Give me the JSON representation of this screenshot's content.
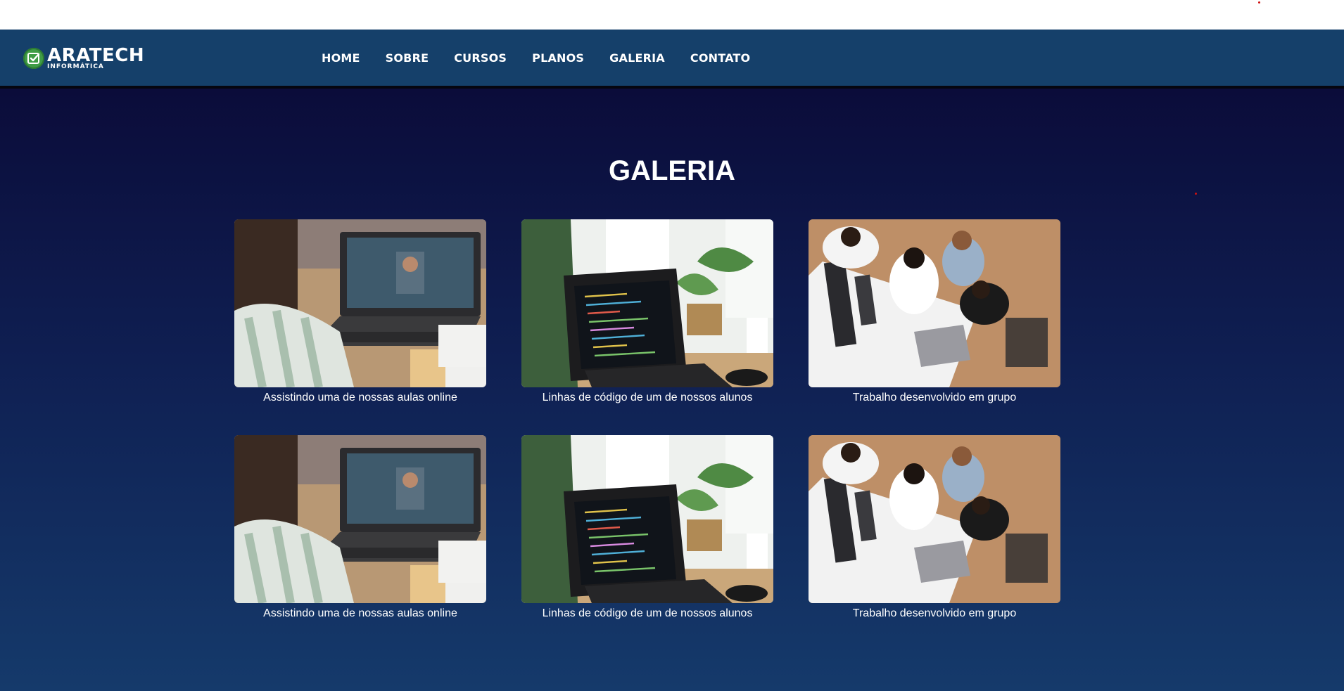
{
  "brand": {
    "name": "ARATECH",
    "subtitle": "INFORMÁTICA",
    "icon": "check-badge-icon",
    "accent_color": "#3f9c45"
  },
  "nav": {
    "items": [
      {
        "label": "HOME"
      },
      {
        "label": "SOBRE"
      },
      {
        "label": "CURSOS"
      },
      {
        "label": "PLANOS"
      },
      {
        "label": "GALERIA"
      },
      {
        "label": "CONTATO"
      }
    ]
  },
  "gallery": {
    "title": "GALERIA",
    "items": [
      {
        "caption": "Assistindo uma de nossas aulas online",
        "image": "online-class-photo"
      },
      {
        "caption": "Linhas de código de um de nossos alunos",
        "image": "code-laptop-photo"
      },
      {
        "caption": "Trabalho desenvolvido em grupo",
        "image": "group-work-photo"
      },
      {
        "caption": "Assistindo uma de nossas aulas online",
        "image": "online-class-photo"
      },
      {
        "caption": "Linhas de código de um de nossos alunos",
        "image": "code-laptop-photo"
      },
      {
        "caption": "Trabalho desenvolvido em grupo",
        "image": "group-work-photo"
      }
    ]
  },
  "colors": {
    "navbar": "#15406a",
    "background_top": "#0b0c3a",
    "background_bottom": "#153a6b",
    "text": "#ffffff"
  }
}
